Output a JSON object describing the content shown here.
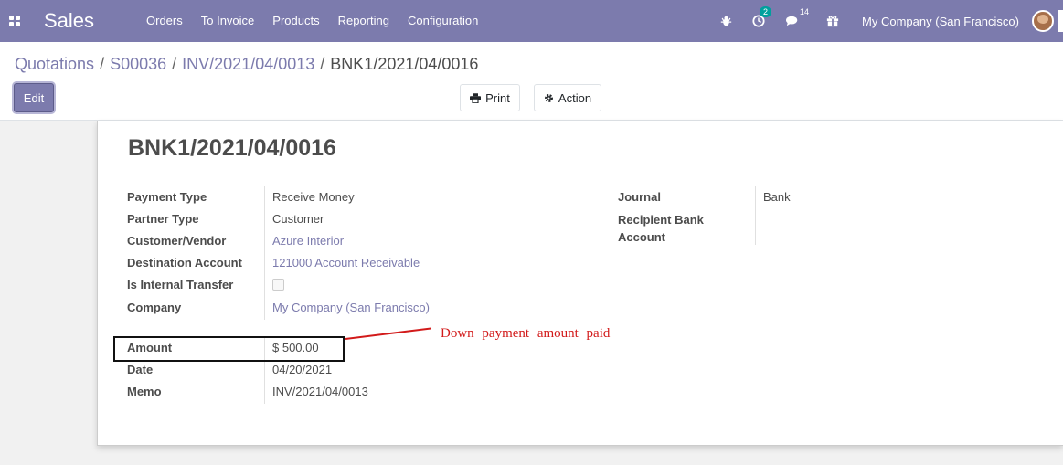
{
  "navbar": {
    "app_name": "Sales",
    "menu": [
      "Orders",
      "To Invoice",
      "Products",
      "Reporting",
      "Configuration"
    ],
    "activity_count": "2",
    "message_count": "14",
    "company": "My Company (San Francisco)",
    "icons": [
      "apps-icon",
      "bug-icon",
      "clock-icon",
      "chat-icon",
      "gift-icon",
      "avatar"
    ]
  },
  "breadcrumb": [
    "Quotations",
    "S00036",
    "INV/2021/04/0013",
    "BNK1/2021/04/0016"
  ],
  "buttons": {
    "edit": "Edit",
    "print": "Print",
    "action": "Action"
  },
  "form": {
    "title": "BNK1/2021/04/0016",
    "left_fields": [
      {
        "label": "Payment Type",
        "value": "Receive Money"
      },
      {
        "label": "Partner Type",
        "value": "Customer"
      },
      {
        "label": "Customer/Vendor",
        "value": "Azure Interior"
      },
      {
        "label": "Destination Account",
        "value": "121000 Account Receivable"
      },
      {
        "label": "Is Internal Transfer",
        "value": ""
      },
      {
        "label": "Company",
        "value": "My Company (San Francisco)"
      }
    ],
    "amount_fields": [
      {
        "label": "Amount",
        "value": "$ 500.00"
      },
      {
        "label": "Date",
        "value": "04/20/2021"
      },
      {
        "label": "Memo",
        "value": "INV/2021/04/0013"
      }
    ],
    "right_fields": [
      {
        "label": "Journal",
        "value": "Bank"
      },
      {
        "label": "Recipient Bank Account",
        "value": ""
      }
    ]
  },
  "annotation": "Down payment amount paid",
  "colors": {
    "brand": "#7c7bad",
    "badge": "#00a09d",
    "annotation": "#d21a1a"
  }
}
